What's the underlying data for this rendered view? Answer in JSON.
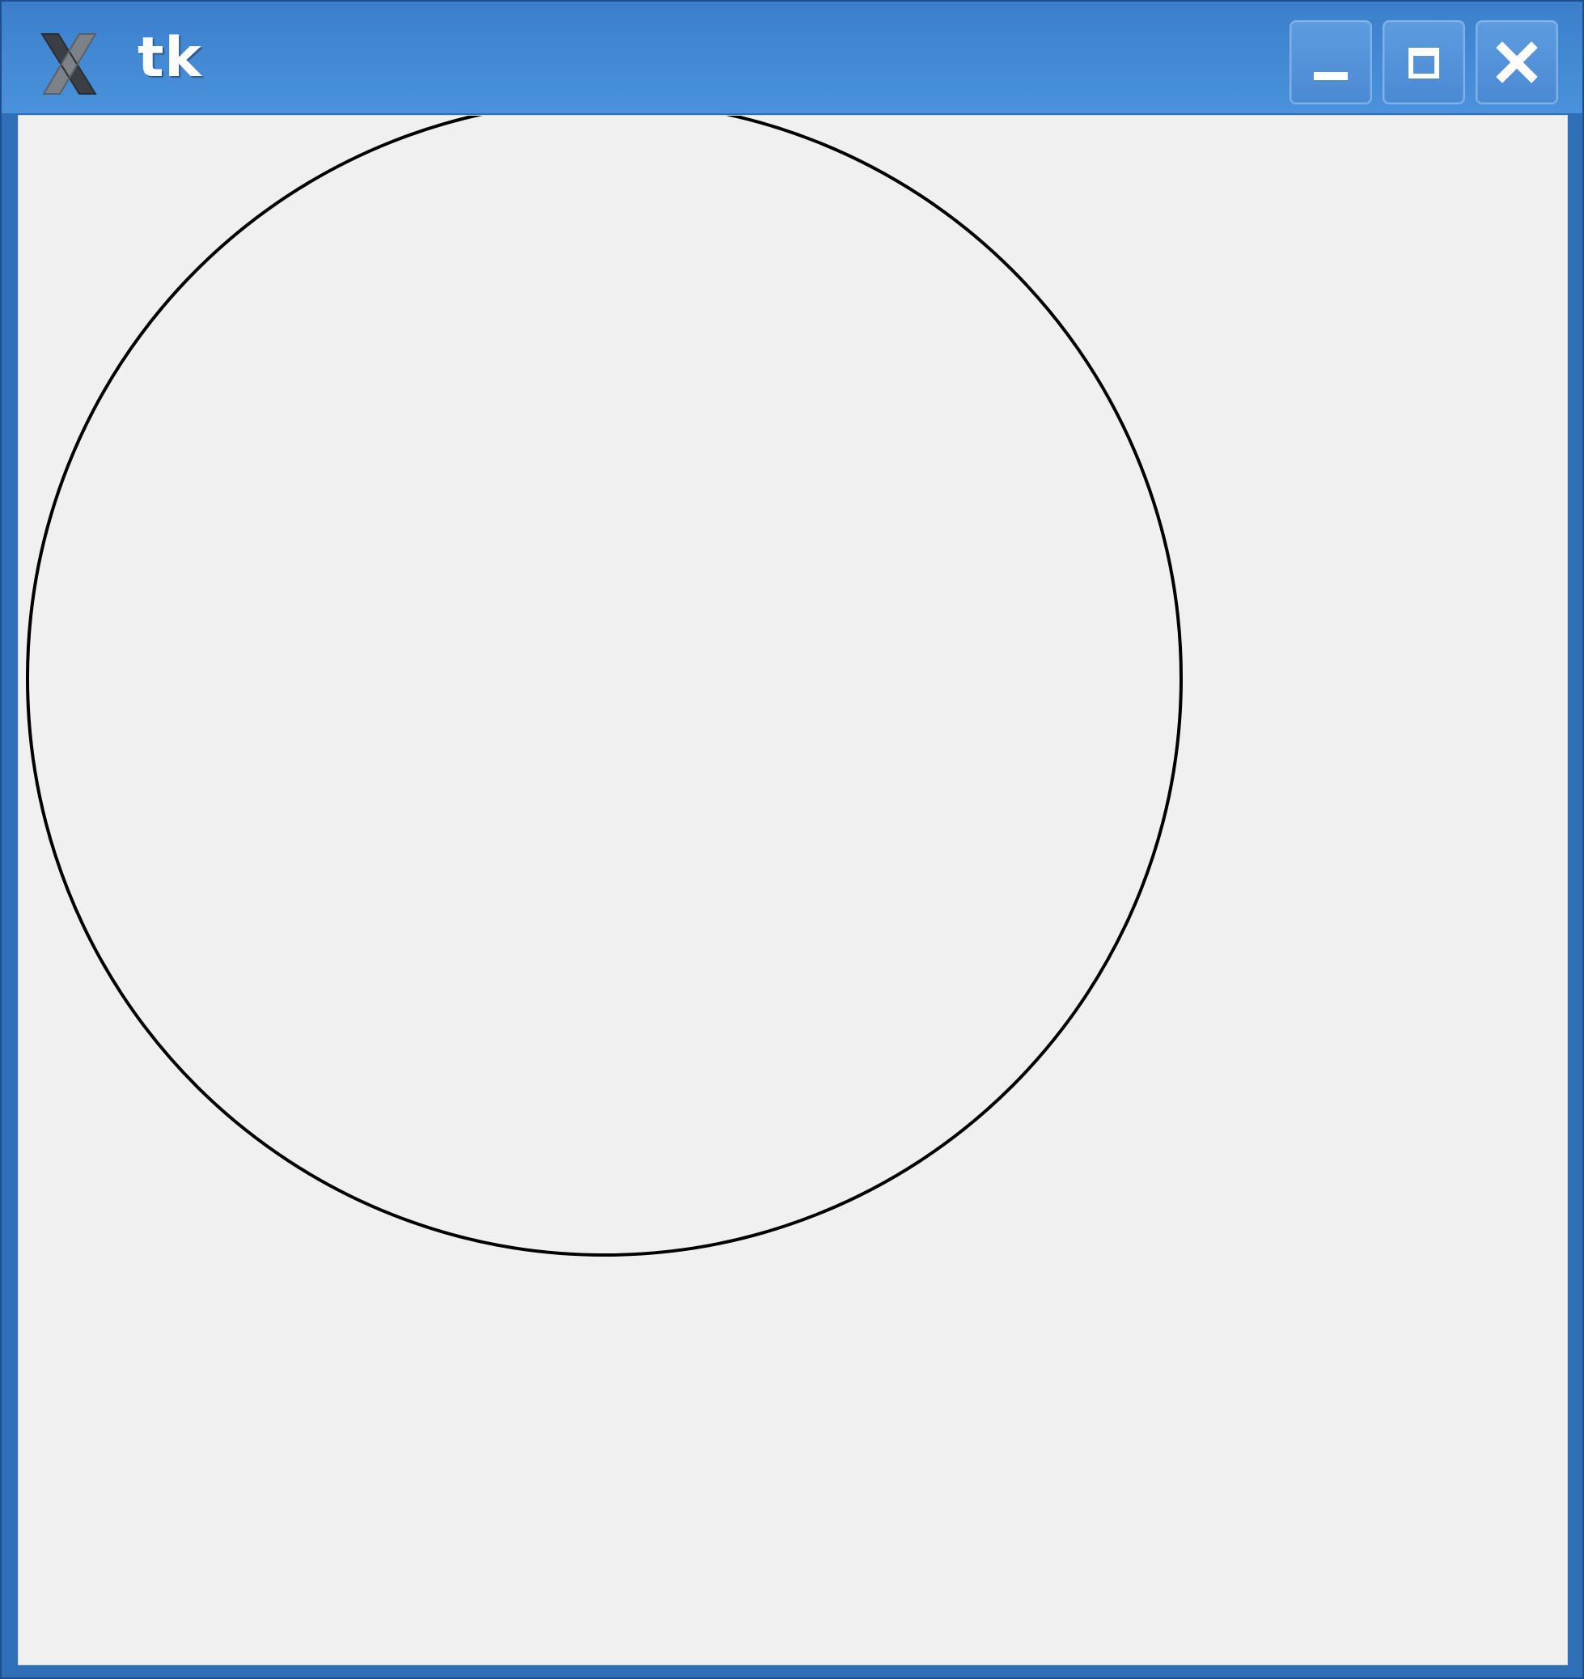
{
  "window": {
    "title": "tk",
    "app_icon": "x-window-icon",
    "controls": {
      "minimize": "minimize-icon",
      "maximize": "maximize-icon",
      "close": "close-icon"
    }
  },
  "canvas": {
    "shapes": [
      {
        "type": "circle",
        "stroke": "#000000",
        "fill": "none"
      }
    ]
  },
  "colors": {
    "titlebar": "#3b7fcb",
    "client_background": "#f0f0f0"
  }
}
